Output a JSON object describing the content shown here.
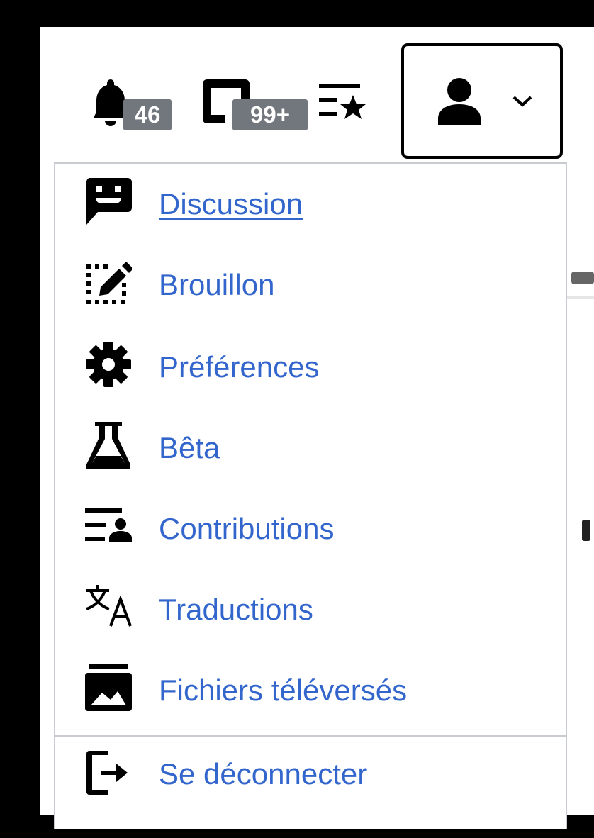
{
  "toolbar": {
    "notifications": {
      "icon": "bell-icon",
      "count": "46"
    },
    "messages": {
      "icon": "tray-icon",
      "count": "99+"
    },
    "watchlist": {
      "icon": "watchlist-star-icon"
    },
    "user_menu": {
      "icon": "user-icon",
      "chevron": "chevron-down-icon"
    }
  },
  "menu": {
    "items": [
      {
        "icon": "speech-bubble-smile-icon",
        "label": "Discussion"
      },
      {
        "icon": "draft-edit-icon",
        "label": "Brouillon"
      },
      {
        "icon": "gear-icon",
        "label": "Préférences"
      },
      {
        "icon": "flask-icon",
        "label": "Bêta"
      },
      {
        "icon": "contributions-icon",
        "label": "Contributions"
      },
      {
        "icon": "translate-icon",
        "label": "Traductions"
      },
      {
        "icon": "uploaded-files-icon",
        "label": "Fichiers téléversés"
      }
    ],
    "logout": {
      "icon": "logout-icon",
      "label": "Se déconnecter"
    }
  },
  "colors": {
    "link": "#3366cc",
    "badge": "#72777d",
    "border": "#c8ccd1"
  }
}
